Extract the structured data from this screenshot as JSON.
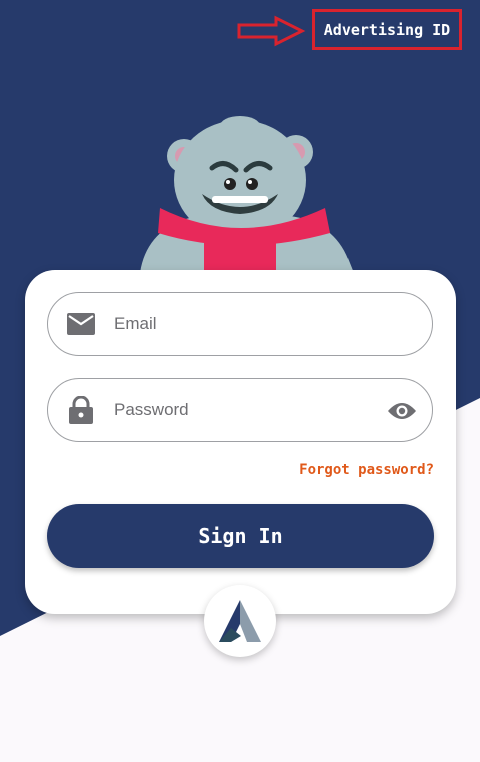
{
  "header": {
    "advertising_id_label": "Advertising ID"
  },
  "login_form": {
    "email_placeholder": "Email",
    "password_placeholder": "Password",
    "forgot_password": "Forgot password?",
    "sign_in": "Sign In"
  },
  "icons": {
    "annotation_arrow": "arrow-right-icon",
    "email": "envelope-icon",
    "password": "lock-icon",
    "show_password": "eye-icon",
    "app_logo": "a-logo-icon",
    "mascot": "bear-mascot"
  },
  "colors": {
    "navy": "#263a6b",
    "annotation_red": "#d9232e",
    "forgot_orange": "#e0591a",
    "background_light": "#fbf9fc"
  }
}
